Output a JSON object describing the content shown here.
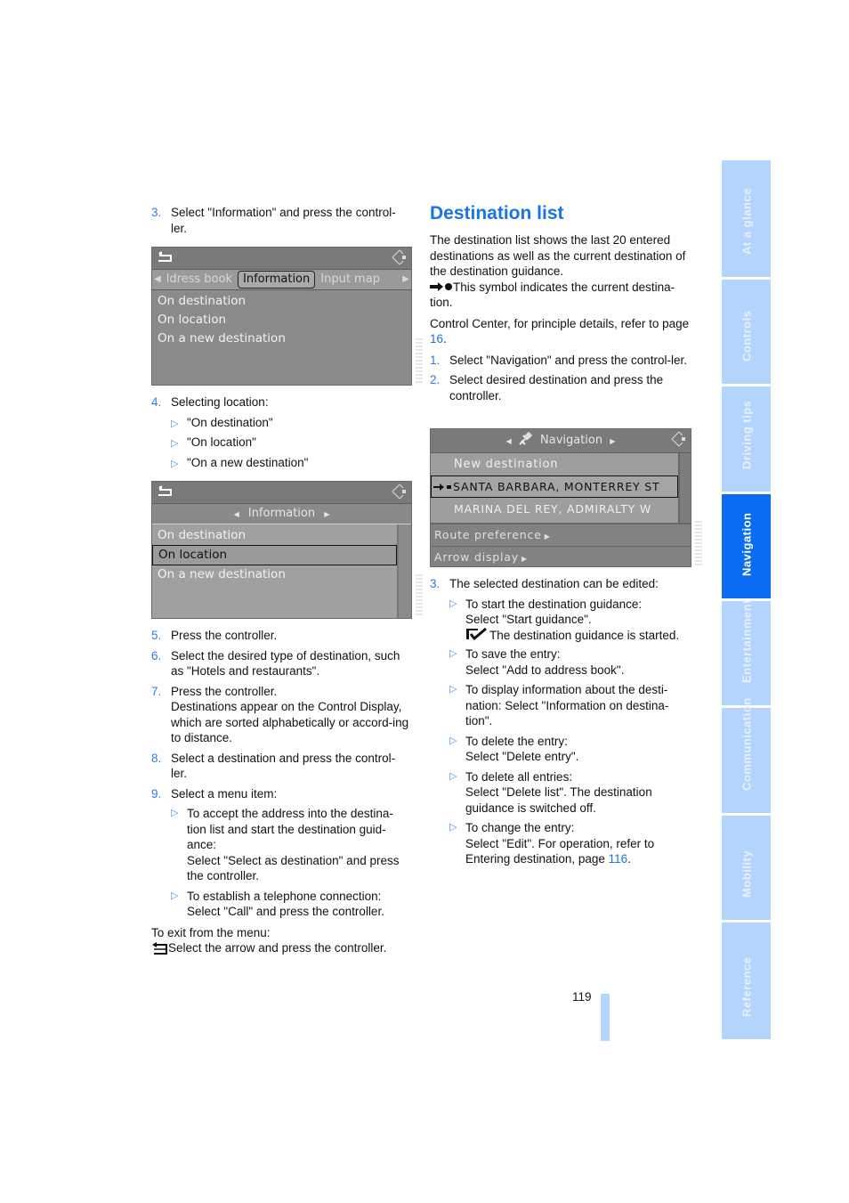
{
  "left": {
    "step3": {
      "num": "3.",
      "text": "Select \"Information\" and press the control-ler."
    },
    "screen1": {
      "tabs": [
        "ldress book",
        "Information",
        "Input map"
      ],
      "items": [
        "On destination",
        "On location",
        "On a new destination"
      ]
    },
    "step4": {
      "num": "4.",
      "text": "Selecting location:",
      "bullets": [
        "\"On destination\"",
        "\"On location\"",
        "\"On a new destination\""
      ]
    },
    "screen2": {
      "title": "Information",
      "items": [
        "On destination",
        "On location",
        "On a new destination"
      ],
      "selected": "On location"
    },
    "step5": {
      "num": "5.",
      "text": "Press the controller."
    },
    "step6": {
      "num": "6.",
      "text": "Select the desired type of destination, such as \"Hotels and restaurants\"."
    },
    "step7": {
      "num": "7.",
      "text": "Press the controller.",
      "text2": "Destinations appear on the Control Display, which are sorted alphabetically or accord-ing to distance."
    },
    "step8": {
      "num": "8.",
      "text": "Select a destination and press the control-ler."
    },
    "step9": {
      "num": "9.",
      "text": "Select a menu item:",
      "bullets": [
        {
          "a": "To accept the address into the destina-tion list and start the destination guid-ance:",
          "b": "Select \"Select as destination\" and press the controller."
        },
        {
          "a": "To establish a telephone connection:",
          "b": "Select \"Call\" and press the controller."
        }
      ]
    },
    "exit_label": "To exit from the menu:",
    "exit_text": "Select the arrow and press the controller."
  },
  "right": {
    "heading": "Destination list",
    "intro": "The destination list shows the last 20 entered destinations as well as the current destination of the destination guidance.",
    "symbol_text": "This symbol indicates the current destina-tion.",
    "cc_text_a": "Control Center, for principle details, refer to page ",
    "cc_page": "16",
    "cc_text_b": ".",
    "step1": {
      "num": "1.",
      "text": "Select \"Navigation\" and press the control-ler."
    },
    "step2": {
      "num": "2.",
      "text": "Select desired destination and press the controller."
    },
    "screen3": {
      "title": "Navigation",
      "items": [
        "New destination",
        "SANTA BARBARA, MONTERREY ST",
        "MARINA DEL REY, ADMIRALTY W"
      ],
      "menu": [
        "Route preference",
        "Arrow display"
      ]
    },
    "step3": {
      "num": "3.",
      "text": "The selected destination can be edited:"
    },
    "bullets": [
      {
        "a": "To start the destination guidance:",
        "b": "Select \"Start guidance\".",
        "c": "The destination guidance is started."
      },
      {
        "a": "To save the entry:",
        "b": "Select \"Add to address book\"."
      },
      {
        "a": "To display information about the desti-nation: Select \"Information on destina-tion\"."
      },
      {
        "a": "To delete the entry:",
        "b": "Select \"Delete entry\"."
      },
      {
        "a": "To delete all entries:",
        "b": "Select \"Delete list\". The destination guidance is switched off."
      },
      {
        "a": "To change the entry:",
        "b_a": "Select \"Edit\". For operation, refer to Entering destination, page ",
        "b_page": "116",
        "b_b": "."
      }
    ]
  },
  "page_number": "119",
  "side_tabs": [
    "At a glance",
    "Controls",
    "Driving tips",
    "Navigation",
    "Entertainment",
    "Communication",
    "Mobility",
    "Reference"
  ],
  "active_tab": "Navigation",
  "colors": {
    "accent": "#1a73e8",
    "tab_light": "#b3d4fc",
    "tab_active": "#0a6cf0"
  }
}
